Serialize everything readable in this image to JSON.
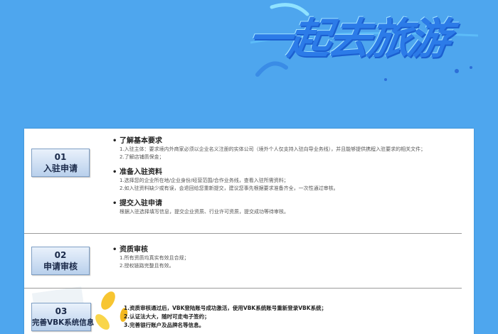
{
  "banner": {
    "title": "一起去旅游",
    "colors": {
      "background": "#4ea6ee",
      "title": "#2c7be8",
      "box_gradient_top": "#e9f1fb",
      "box_gradient_bottom": "#b9d0ec"
    }
  },
  "steps": [
    {
      "number": "01",
      "name": "入驻申请",
      "sections": [
        {
          "title": "了解基本要求",
          "lines": [
            "1.入驻主体：要求境内外商家必须以企业名义注册的实体公司（境外个人仅支持入驻向导业务线），并且能够提供携程入驻要求的相关文件；",
            "2.了解店铺质保金；"
          ]
        },
        {
          "title": "准备入驻资料",
          "lines": [
            "1.选择您的企业所在地/企业身份/经营范围/合作业务线，查看入驻所需资料；",
            "2.如入驻资料缺少或有误，会退回给您重新提交，建议您事先根据要求准备齐全，一次性通过审核。"
          ]
        },
        {
          "title": "提交入驻申请",
          "lines": [
            "根据入驻选择填写信息，提交企业资质、行业许可资质，提交成功等待审核。"
          ]
        }
      ]
    },
    {
      "number": "02",
      "name": "申请审核",
      "sections": [
        {
          "title": "资质审核",
          "lines": [
            "1.所有资质均真实有效且合规；",
            "2.授权链路完整且有效。"
          ]
        }
      ]
    },
    {
      "number": "03",
      "name": "完善VBK系统信息",
      "sections": [
        {
          "title": "",
          "lines": [
            "1.资质审核通过后，VBK登陆账号成功激活，使用VBK系统账号重新登录VBK系统；",
            "2.认证法大大，随时可走电子签约；",
            "3.完善银行账户及品牌名等信息。"
          ]
        }
      ]
    }
  ]
}
